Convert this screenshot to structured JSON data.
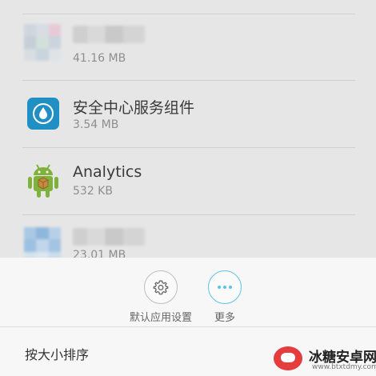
{
  "app_list": {
    "items": [
      {
        "title": "",
        "size": "41.16 MB",
        "icon": "blurred-app-icon"
      },
      {
        "title": "安全中心服务组件",
        "size": "3.54 MB",
        "icon": "security-water-drop-icon"
      },
      {
        "title": "Analytics",
        "size": "532 KB",
        "icon": "android-robot-icon"
      },
      {
        "title": "",
        "size": "23.01 MB",
        "icon": "blurred-app-icon"
      }
    ]
  },
  "bottom_sheet": {
    "actions": [
      {
        "label": "默认应用设置",
        "icon": "gear-icon"
      },
      {
        "label": "更多",
        "icon": "more-dots-icon"
      }
    ],
    "sort_label": "按大小排序"
  },
  "watermark": {
    "name": "冰糖安卓网",
    "url": "www.btxtdmy.com"
  },
  "colors": {
    "accent": "#5cc2e8",
    "security_icon_bg": "#1f8fc4",
    "android_green": "#7fb23a"
  }
}
